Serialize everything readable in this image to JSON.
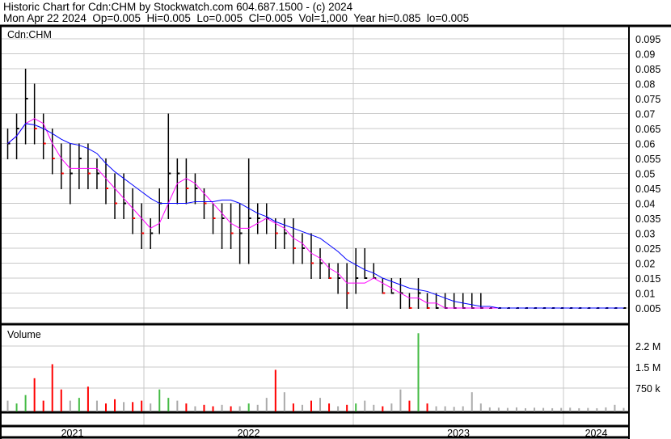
{
  "header": {
    "title": "Historic Chart for Cdn:CHM by Stockwatch.com 604.687.1500 - (c) 2024",
    "quote": "Mon Apr 22 2024  Op=0.005  Hi=0.005  Lo=0.005  Cl=0.005  Vol=1,000  Year hi=0.085  lo=0.005"
  },
  "chart_data": [
    {
      "type": "bar",
      "title": "Cdn:CHM",
      "subtype": "hi-lo price bars with moving averages",
      "y_ticks": [
        "0.005",
        "0.01",
        "0.015",
        "0.02",
        "0.025",
        "0.03",
        "0.035",
        "0.04",
        "0.045",
        "0.05",
        "0.055",
        "0.06",
        "0.065",
        "0.07",
        "0.075",
        "0.08",
        "0.085",
        "0.09",
        "0.095"
      ],
      "ylim": [
        0,
        0.1
      ],
      "x_labels": [
        "2021",
        "2022",
        "2023",
        "2024"
      ],
      "colors": {
        "bar": "#000000",
        "down_tick": "#ff0000",
        "ma_short": "#ff00ff",
        "ma_long": "#0000ff"
      },
      "hi": [
        0.065,
        0.07,
        0.085,
        0.08,
        0.07,
        0.065,
        0.06,
        0.06,
        0.06,
        0.06,
        0.055,
        0.055,
        0.05,
        0.05,
        0.045,
        0.04,
        0.035,
        0.045,
        0.07,
        0.055,
        0.055,
        0.05,
        0.045,
        0.04,
        0.04,
        0.04,
        0.04,
        0.055,
        0.04,
        0.04,
        0.035,
        0.035,
        0.035,
        0.03,
        0.03,
        0.025,
        0.02,
        0.02,
        0.02,
        0.025,
        0.025,
        0.02,
        0.015,
        0.015,
        0.015,
        0.01,
        0.015,
        0.01,
        0.01,
        0.01,
        0.01,
        0.01,
        0.01,
        0.01,
        0.005,
        0.005,
        0.005,
        0.005,
        0.005,
        0.005,
        0.005,
        0.005,
        0.005,
        0.005,
        0.005,
        0.005,
        0.005,
        0.005,
        0.005,
        0.005
      ],
      "lo": [
        0.055,
        0.055,
        0.06,
        0.06,
        0.055,
        0.05,
        0.045,
        0.04,
        0.045,
        0.045,
        0.045,
        0.04,
        0.035,
        0.035,
        0.03,
        0.025,
        0.025,
        0.03,
        0.035,
        0.04,
        0.04,
        0.04,
        0.035,
        0.03,
        0.025,
        0.025,
        0.02,
        0.02,
        0.03,
        0.03,
        0.025,
        0.025,
        0.02,
        0.02,
        0.015,
        0.015,
        0.015,
        0.01,
        0.005,
        0.01,
        0.015,
        0.015,
        0.01,
        0.01,
        0.005,
        0.005,
        0.005,
        0.005,
        0.005,
        0.005,
        0.005,
        0.005,
        0.005,
        0.005,
        0.005,
        0.005,
        0.005,
        0.005,
        0.005,
        0.005,
        0.005,
        0.005,
        0.005,
        0.005,
        0.005,
        0.005,
        0.005,
        0.005,
        0.005,
        0.005
      ],
      "close": [
        0.06,
        0.065,
        0.075,
        0.065,
        0.06,
        0.055,
        0.05,
        0.05,
        0.055,
        0.05,
        0.05,
        0.045,
        0.04,
        0.04,
        0.035,
        0.03,
        0.03,
        0.04,
        0.05,
        0.05,
        0.045,
        0.045,
        0.04,
        0.035,
        0.035,
        0.03,
        0.03,
        0.035,
        0.035,
        0.035,
        0.03,
        0.03,
        0.025,
        0.025,
        0.02,
        0.02,
        0.015,
        0.015,
        0.01,
        0.015,
        0.015,
        0.015,
        0.01,
        0.01,
        0.01,
        0.005,
        0.01,
        0.005,
        0.005,
        0.005,
        0.005,
        0.005,
        0.005,
        0.005,
        0.005,
        0.005,
        0.005,
        0.005,
        0.005,
        0.005,
        0.005,
        0.005,
        0.005,
        0.005,
        0.005,
        0.005,
        0.005,
        0.005,
        0.005,
        0.005
      ]
    },
    {
      "type": "bar",
      "title": "Volume",
      "y_ticks": [
        "750 k",
        "1.5 M",
        "2.2 M"
      ],
      "ylim": [
        0,
        2900
      ],
      "units": "thousands",
      "colors": {
        "up": "#44bb44",
        "down": "#ff0000",
        "flat": "#aaaaaa"
      },
      "values": [
        300,
        200,
        500,
        1100,
        300,
        1600,
        700,
        300,
        400,
        800,
        300,
        200,
        350,
        250,
        250,
        300,
        200,
        700,
        400,
        300,
        200,
        100,
        150,
        100,
        150,
        100,
        100,
        200,
        150,
        400,
        1400,
        600,
        200,
        150,
        300,
        400,
        200,
        100,
        150,
        200,
        300,
        150,
        100,
        200,
        700,
        300,
        2700,
        200,
        100,
        100,
        80,
        100,
        600,
        200,
        60,
        50,
        40,
        60,
        30,
        50,
        40,
        30,
        40,
        50,
        30,
        40,
        30,
        60,
        150,
        40
      ]
    }
  ]
}
